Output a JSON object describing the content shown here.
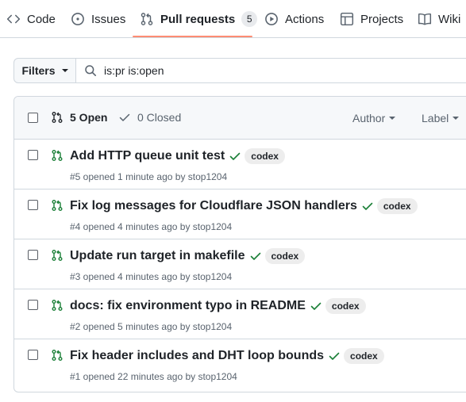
{
  "tabs": [
    {
      "label": "Code",
      "icon": "code-icon"
    },
    {
      "label": "Issues",
      "icon": "issue-opened-icon"
    },
    {
      "label": "Pull requests",
      "icon": "git-pull-request-icon",
      "counter": "5"
    },
    {
      "label": "Actions",
      "icon": "play-icon"
    },
    {
      "label": "Projects",
      "icon": "table-icon"
    },
    {
      "label": "Wiki",
      "icon": "book-icon"
    }
  ],
  "filter": {
    "button_label": "Filters",
    "query": "is:pr is:open"
  },
  "list_header": {
    "open_label": "5 Open",
    "closed_label": "0 Closed",
    "author_label": "Author",
    "label_label": "Label"
  },
  "pull_requests": [
    {
      "title": "Add HTTP queue unit test",
      "label": "codex",
      "meta": "#5 opened 1 minute ago by stop1204"
    },
    {
      "title": "Fix log messages for Cloudflare JSON handlers",
      "label": "codex",
      "meta": "#4 opened 4 minutes ago by stop1204"
    },
    {
      "title": "Update run target in makefile",
      "label": "codex",
      "meta": "#3 opened 4 minutes ago by stop1204"
    },
    {
      "title": "docs: fix environment typo in README",
      "label": "codex",
      "meta": "#2 opened 5 minutes ago by stop1204"
    },
    {
      "title": "Fix header includes and DHT loop bounds",
      "label": "codex",
      "meta": "#1 opened 22 minutes ago by stop1204"
    }
  ],
  "colors": {
    "open_pr": "#1a7f37",
    "active_tab_underline": "#fd8c73",
    "check_success": "#1a7f37"
  }
}
